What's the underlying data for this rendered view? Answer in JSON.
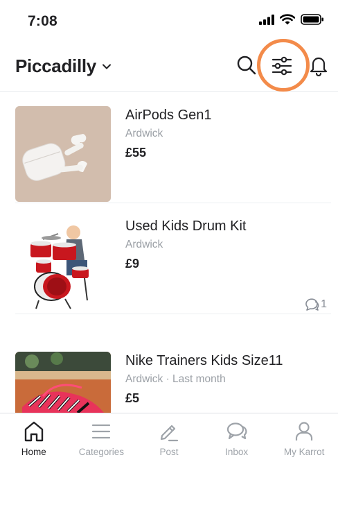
{
  "status_bar": {
    "time": "7:08"
  },
  "header": {
    "location": "Piccadilly"
  },
  "listings": [
    {
      "title": "AirPods Gen1",
      "meta": "Ardwick",
      "price": "£55",
      "chats": ""
    },
    {
      "title": "Used Kids Drum Kit",
      "meta": "Ardwick",
      "price": "£9",
      "chats": "1"
    },
    {
      "title": "Nike Trainers Kids Size11",
      "meta": "Ardwick · Last month",
      "price": "£5",
      "chats": ""
    }
  ],
  "nav": {
    "tabs": [
      {
        "label": "Home",
        "icon": "home-icon"
      },
      {
        "label": "Categories",
        "icon": "menu-icon"
      },
      {
        "label": "Post",
        "icon": "pencil-icon"
      },
      {
        "label": "Inbox",
        "icon": "chat-icon"
      },
      {
        "label": "My Karrot",
        "icon": "person-icon"
      }
    ]
  },
  "colors": {
    "highlight": "#f38b4a",
    "text": "#212124",
    "muted": "#9a9fa5"
  }
}
